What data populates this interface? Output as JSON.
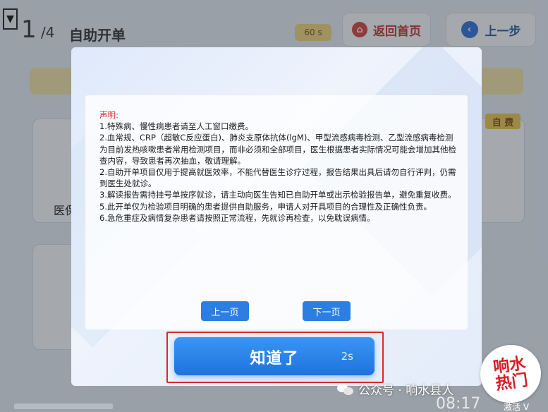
{
  "header": {
    "dropdown_glyph": "▼",
    "step_current": "1",
    "step_total": "/4",
    "title": "自助开单",
    "timer": "60 s",
    "home_button": "返回首页",
    "back_button": "上一步"
  },
  "background": {
    "card_label": "医保",
    "self_pay_tag": "自 费"
  },
  "modal": {
    "heading": "声明:",
    "lines": [
      "1.特殊病、慢性病患者请至人工窗口缴费。",
      "2.血常规、CRP（超敏C反应蛋白)、肺炎支原体抗体(lgM)、甲型流感病毒检测、乙型流感病毒检测为目前发热咳嗽患者常用检测项目，而非必须和全部项目，医生根据患者实际情况可能会增加其他检查内容，导致患者再次抽血，敬请理解。",
      "2.自助开单项目仅用于提高就医效率，不能代替医生诊疗过程，报告结果出具后请勿自行评判，仍需到医生处就诊。",
      "3.解读报告需持挂号单按序就诊，请主动向医生告知已自助开单或出示检验报告单，避免重复收费。",
      "5.此开单仅为检验项目明确的患者提供自助服务，申请人对开具项目的合理性及正确性负责。",
      "6.急危重症及病情复杂患者请按照正常流程，先就诊再检查，以免耽误病情。"
    ],
    "prev_page": "上一页",
    "next_page": "下一页",
    "confirm": "知道了",
    "countdown": "2s"
  },
  "overlay": {
    "watermark": "公众号 · 响水县人",
    "clock": "08:17",
    "logo_line1": "响水",
    "logo_line2": "热门",
    "corner_text": "激活 V"
  },
  "colors": {
    "primary_blue": "#2c7fe0",
    "highlight_red": "#e0262b",
    "heading_red": "#d22a2a"
  }
}
